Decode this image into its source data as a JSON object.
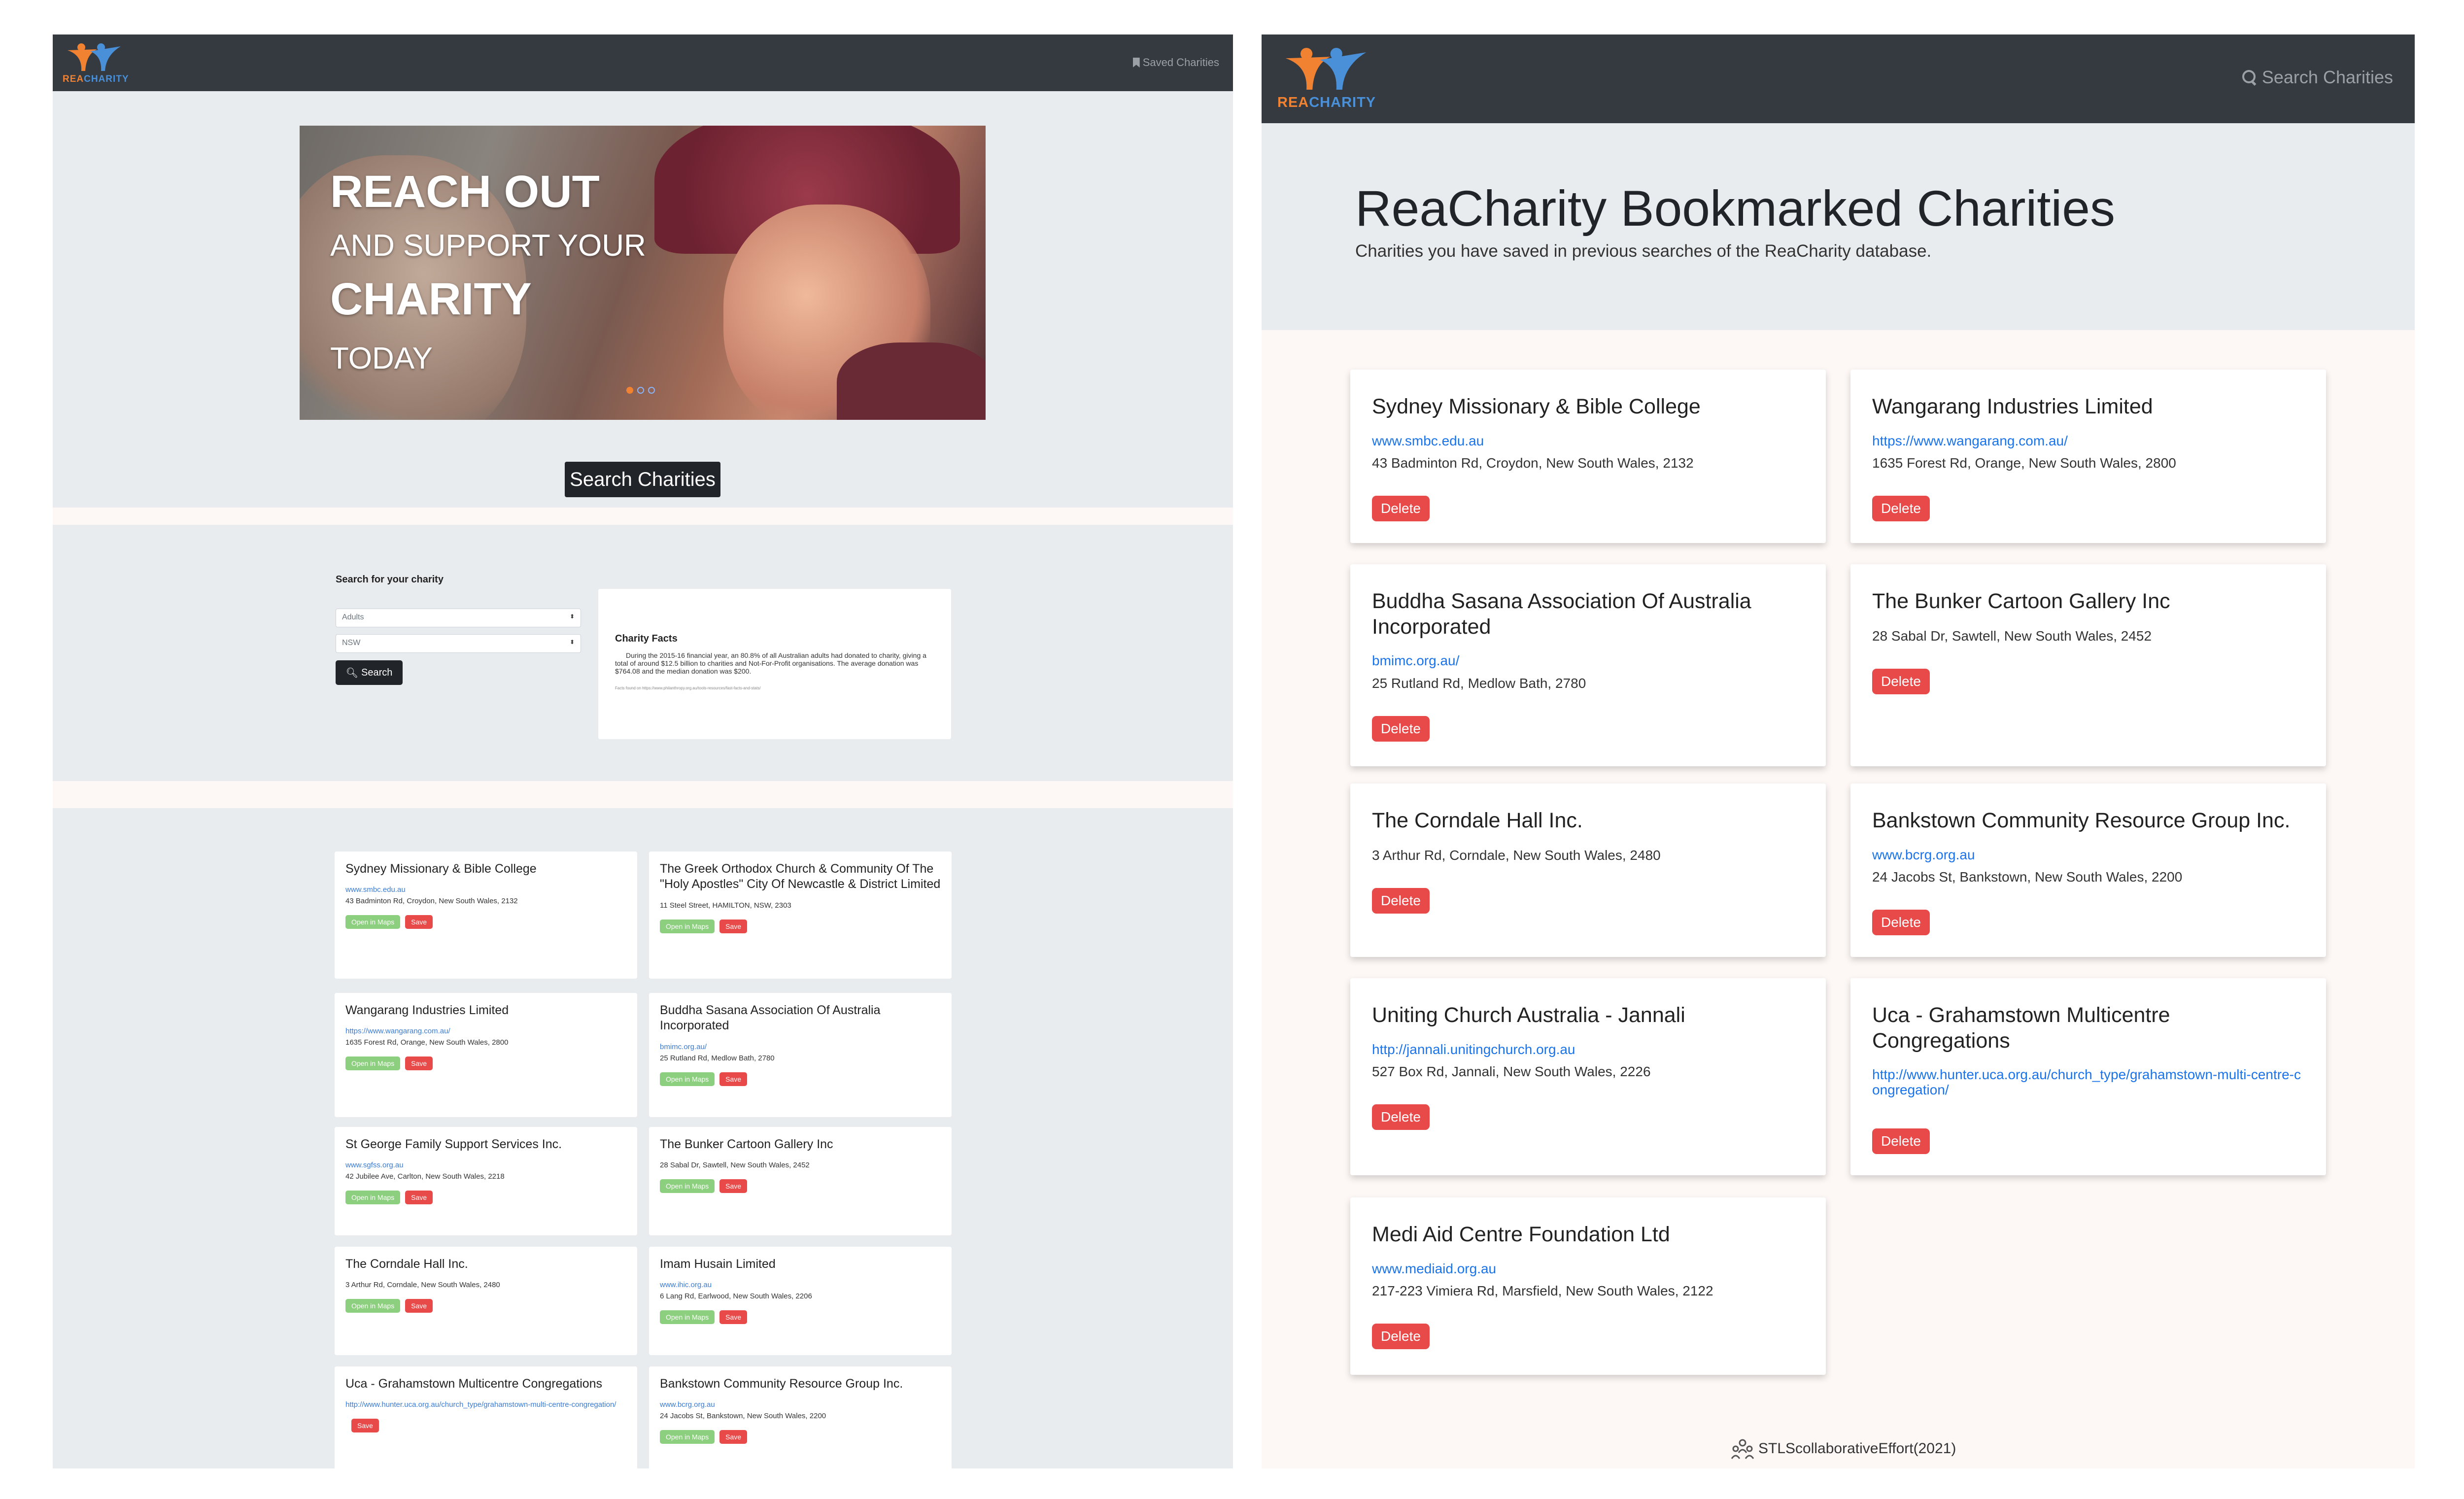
{
  "left": {
    "brand": {
      "rea": "REA",
      "charity": "CHARITY"
    },
    "nav_saved": "Saved Charities",
    "hero": {
      "line1": "REACH OUT",
      "line2": "AND SUPPORT YOUR",
      "line3": "CHARITY",
      "line4": "TODAY"
    },
    "search_charities_button": "Search Charities",
    "search_title": "Search for your charity",
    "select1": "Adults",
    "select2": "NSW",
    "search_button": "Search",
    "facts_title": "Charity Facts",
    "facts_text": "During the 2015-16 financial year, an 80.8% of all Australian adults had donated to charity, giving a total of around $12.5 billion to charities and Not-For-Profit organisations. The average donation was $764.08 and the median donation was $200.",
    "facts_source": "Facts found on https://www.philanthropy.org.au/tools-resources/fast-facts-and-stats/",
    "results": [
      {
        "title": "Sydney Missionary & Bible College",
        "url": "www.smbc.edu.au",
        "address": "43 Badminton Rd, Croydon, New South Wales, 2132",
        "maps": "Open in Maps",
        "save": "Save"
      },
      {
        "title": "The Greek Orthodox Church & Community Of The \"Holy Apostles\" City Of Newcastle & District Limited",
        "url": "",
        "address": "11 Steel Street, HAMILTON, NSW, 2303",
        "maps": "Open in Maps",
        "save": "Save"
      },
      {
        "title": "Wangarang Industries Limited",
        "url": "https://www.wangarang.com.au/",
        "address": "1635 Forest Rd, Orange, New South Wales, 2800",
        "maps": "Open in Maps",
        "save": "Save"
      },
      {
        "title": "Buddha Sasana Association Of Australia Incorporated",
        "url": "bmimc.org.au/",
        "address": "25 Rutland Rd, Medlow Bath, 2780",
        "maps": "Open in Maps",
        "save": "Save"
      },
      {
        "title": "St George Family Support Services Inc.",
        "url": "www.sgfss.org.au",
        "address": "42 Jubilee Ave, Carlton, New South Wales, 2218",
        "maps": "Open in Maps",
        "save": "Save"
      },
      {
        "title": "The Bunker Cartoon Gallery Inc",
        "url": "",
        "address": "28 Sabal Dr, Sawtell, New South Wales, 2452",
        "maps": "Open in Maps",
        "save": "Save"
      },
      {
        "title": "The Corndale Hall Inc.",
        "url": "",
        "address": "3 Arthur Rd, Corndale, New South Wales, 2480",
        "maps": "Open in Maps",
        "save": "Save"
      },
      {
        "title": "Imam Husain Limited",
        "url": "www.ihic.org.au",
        "address": "6 Lang Rd, Earlwood, New South Wales, 2206",
        "maps": "Open in Maps",
        "save": "Save"
      },
      {
        "title": "Uca - Grahamstown Multicentre Congregations",
        "url": "http://www.hunter.uca.org.au/church_type/grahamstown-multi-centre-congregation/",
        "address": "",
        "maps": "",
        "save": "Save"
      },
      {
        "title": "Bankstown Community Resource Group Inc.",
        "url": "www.bcrg.org.au",
        "address": "24 Jacobs St, Bankstown, New South Wales, 2200",
        "maps": "Open in Maps",
        "save": "Save"
      }
    ]
  },
  "right": {
    "brand": {
      "rea": "REA",
      "charity": "CHARITY"
    },
    "nav_search": "Search Charities",
    "title": "ReaCharity Bookmarked Charities",
    "subtitle": "Charities you have saved in previous searches of the ReaCharity database.",
    "bookmarks": [
      {
        "title": "Sydney Missionary & Bible College",
        "url": "www.smbc.edu.au",
        "address": "43 Badminton Rd, Croydon, New South Wales, 2132",
        "delete": "Delete"
      },
      {
        "title": "Wangarang Industries Limited",
        "url": "https://www.wangarang.com.au/",
        "address": "1635 Forest Rd, Orange, New South Wales, 2800",
        "delete": "Delete"
      },
      {
        "title": "Buddha Sasana Association Of Australia Incorporated",
        "url": "bmimc.org.au/",
        "address": "25 Rutland Rd, Medlow Bath, 2780",
        "delete": "Delete"
      },
      {
        "title": "The Bunker Cartoon Gallery Inc",
        "url": "",
        "address": "28 Sabal Dr, Sawtell, New South Wales, 2452",
        "delete": "Delete"
      },
      {
        "title": "The Corndale Hall Inc.",
        "url": "",
        "address": "3 Arthur Rd, Corndale, New South Wales, 2480",
        "delete": "Delete"
      },
      {
        "title": "Bankstown Community Resource Group Inc.",
        "url": "www.bcrg.org.au",
        "address": "24 Jacobs St, Bankstown, New South Wales, 2200",
        "delete": "Delete"
      },
      {
        "title": "Uniting Church Australia - Jannali",
        "url": "http://jannali.unitingchurch.org.au",
        "address": "527 Box Rd, Jannali, New South Wales, 2226",
        "delete": "Delete"
      },
      {
        "title": "Uca - Grahamstown Multicentre Congregations",
        "url": "http://www.hunter.uca.org.au/church_type/grahamstown-multi-centre-congregation/",
        "address": "",
        "delete": "Delete"
      },
      {
        "title": "Medi Aid Centre Foundation Ltd",
        "url": "www.mediaid.org.au",
        "address": "217-223 Vimiera Rd, Marsfield, New South Wales, 2122",
        "delete": "Delete"
      }
    ],
    "footer": "STLScollaborativeEffort(2021)"
  },
  "colors": {
    "navbar": "#343a40",
    "delete": "#e84a4a",
    "maps": "#8ccf7e",
    "link": "#1a73e8",
    "rea": "#f08232",
    "charity": "#4a90d9"
  }
}
